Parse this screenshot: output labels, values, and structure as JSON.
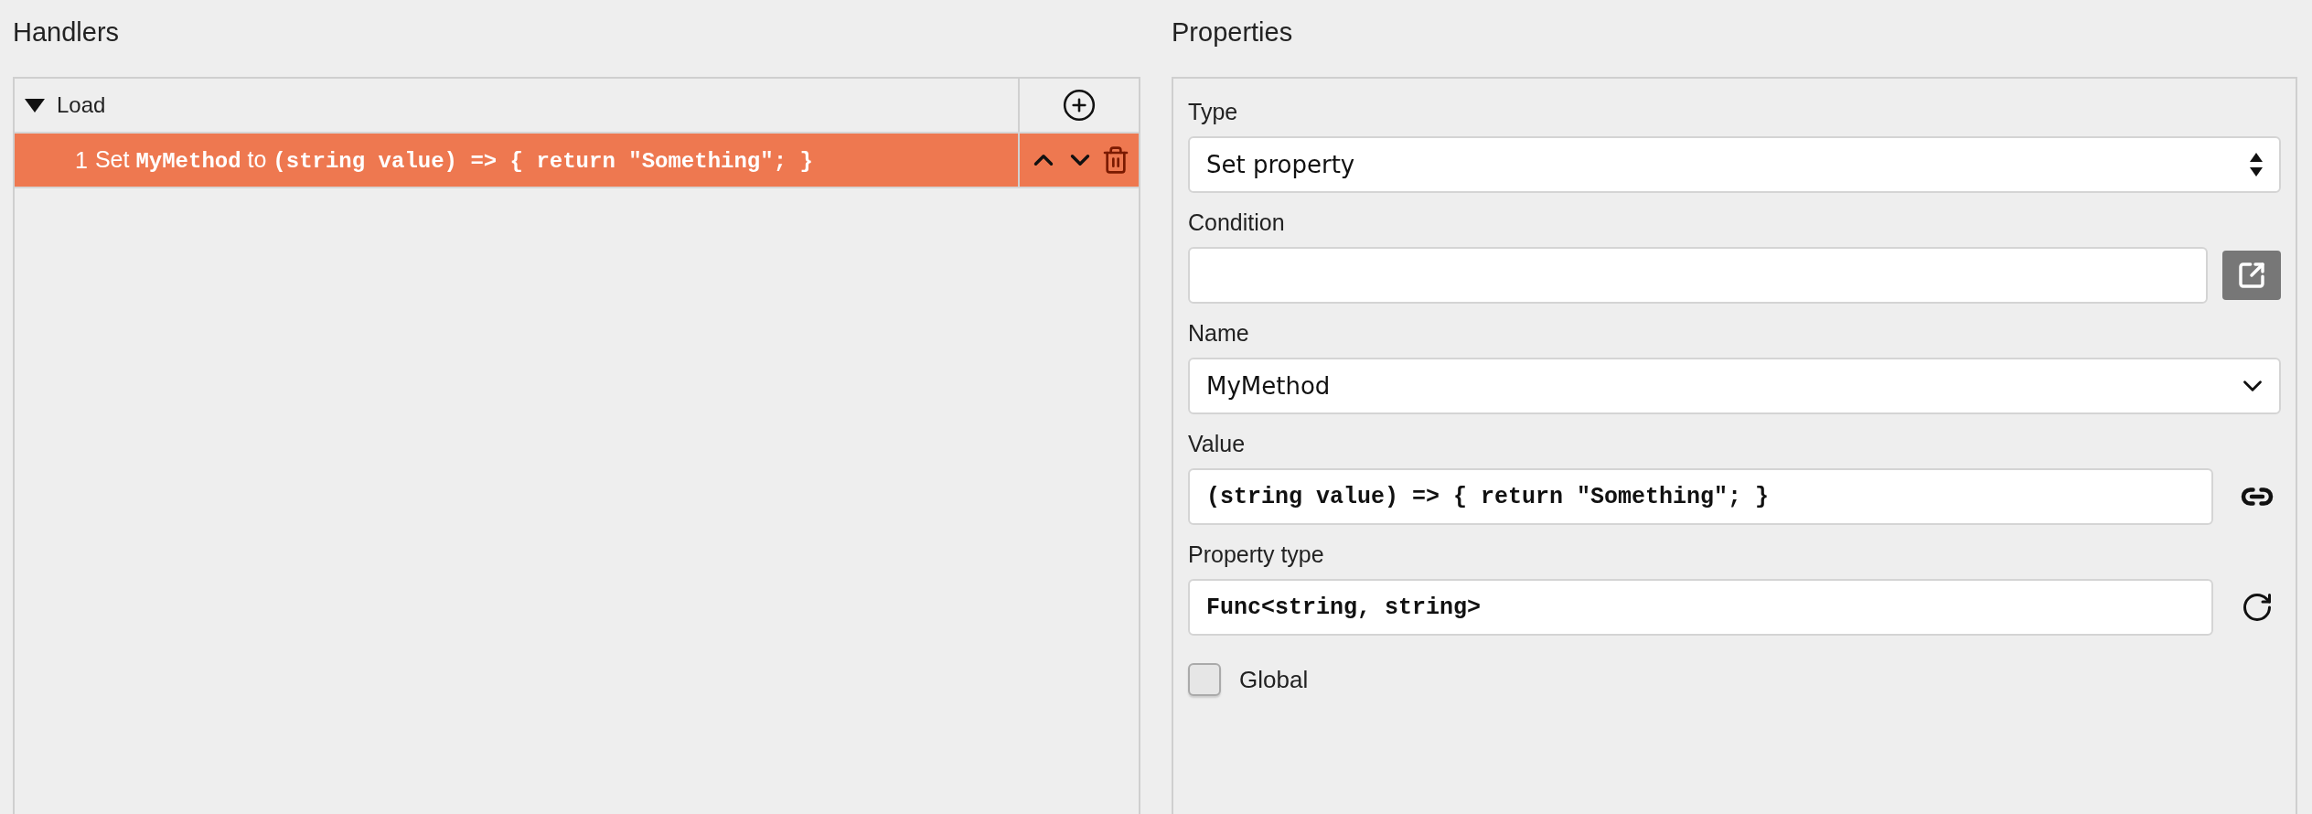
{
  "handlers": {
    "title": "Handlers",
    "groups": [
      {
        "name": "Load",
        "expanded": true,
        "actions": [
          {
            "number": "1",
            "summary": "Set **MyMethod** to **(string value) => { return \"Something\"; }**",
            "selected": true
          }
        ]
      }
    ]
  },
  "properties": {
    "title": "Properties",
    "fields": [
      {
        "label": "Type",
        "kind": "select",
        "value": "Set property"
      },
      {
        "label": "Condition",
        "kind": "input",
        "accessory": {
          "kind": "popout"
        }
      },
      {
        "label": "Name",
        "kind": "dropdown",
        "value": "MyMethod"
      },
      {
        "label": "Value",
        "kind": "code",
        "value": "(string value) => { return \"Something\"; }",
        "accessory": {
          "kind": "link"
        }
      },
      {
        "label": "Property type",
        "kind": "code",
        "value": "Func<string, string>",
        "accessory": {
          "kind": "reset"
        }
      }
    ],
    "global": {
      "label": "Global",
      "checked": false
    }
  }
}
